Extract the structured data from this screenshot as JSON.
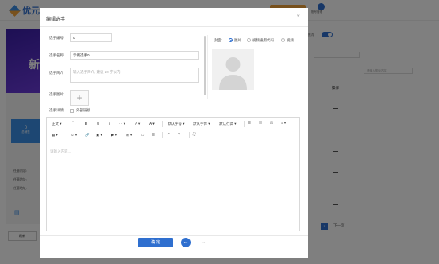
{
  "background": {
    "brand": "优元",
    "user_label": "账号管理",
    "switch_label": "推荐",
    "banner_text": "新",
    "card_value": "0",
    "card_label": "总销售",
    "side_items": [
      "任意内容:",
      "任意地址:",
      "任意地址:"
    ],
    "search2_placeholder": "请输入搜索内容",
    "col_header": "操作",
    "bottom_button": "刷新",
    "pagination": {
      "current": "1",
      "next": "下一页"
    }
  },
  "modal": {
    "title": "编辑选手",
    "close_icon": "×",
    "form": {
      "number_label": "选手编号",
      "number_value": "0",
      "name_label": "选手名称",
      "name_value": "示例选手0",
      "intro_label": "选手简介",
      "intro_placeholder": "输入选手简介, 建议 20 字以内",
      "image_label": "选手图片",
      "image_add": "+",
      "detail_label": "选手详情",
      "external_link_label": "外部链接"
    },
    "media": {
      "label": "封面:",
      "options": [
        "图片",
        "视频通用代码",
        "视频"
      ],
      "selected": "图片"
    },
    "toolbar": {
      "row1": [
        "正文",
        "❝",
        "B",
        "U",
        "I",
        "···",
        "A",
        "A",
        "默认字号",
        "默认字体",
        "默认行高",
        "☰",
        "☷",
        "☑",
        "≡"
      ],
      "row2": [
        "▦",
        "☺",
        "🔗",
        "▣",
        "▶",
        "⊞",
        "<>",
        "☰",
        "↶",
        "↷",
        "⛶"
      ]
    },
    "editor_placeholder": "请输入内容...",
    "confirm_button": "确 定",
    "prev_icon": "←",
    "next_icon": "→"
  },
  "colors": {
    "primary": "#2f6fcf",
    "accent": "#f0a23a"
  }
}
